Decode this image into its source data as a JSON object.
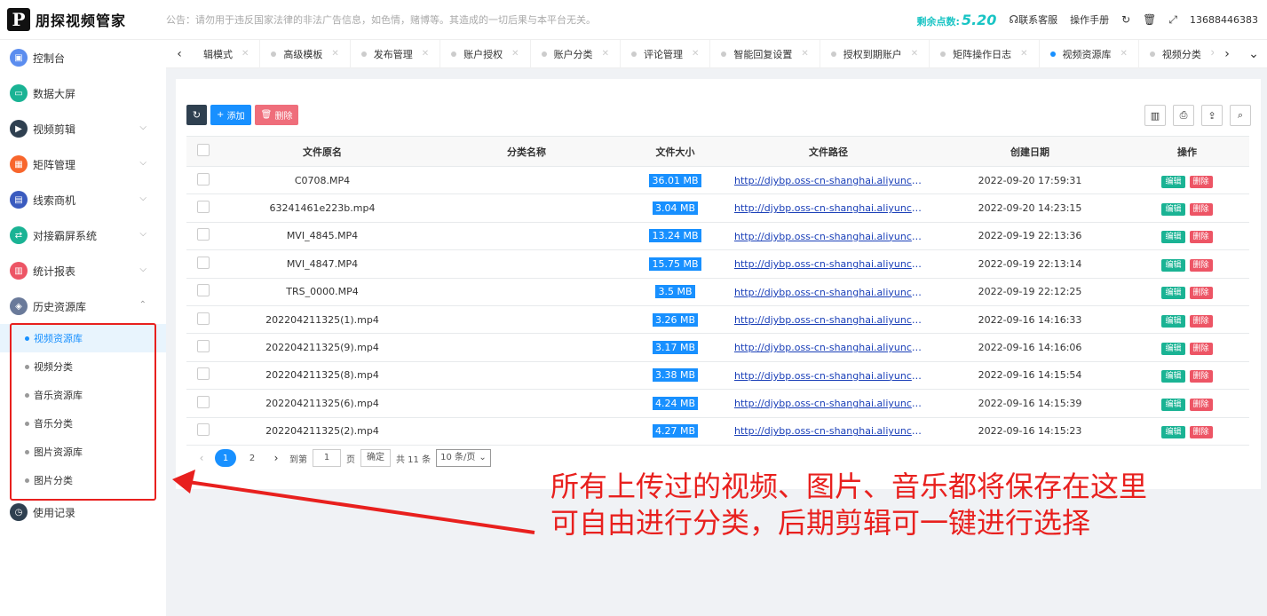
{
  "header": {
    "logo_mark": "P",
    "logo_text": "朋探视频管家",
    "notice": "公告：请勿用于违反国家法律的非法广告信息，如色情，赌博等。其造成的一切后果与本平台无关。",
    "points_label": "剩余点数:",
    "points_value": "5.20",
    "contact": "联系客服",
    "manual": "操作手册",
    "phone": "13688446383"
  },
  "sidebar": {
    "items": [
      {
        "label": "控制台",
        "color": "#5b8def",
        "icon": "dashboard-icon"
      },
      {
        "label": "数据大屏",
        "color": "#1ab394",
        "icon": "screen-icon"
      },
      {
        "label": "视频剪辑",
        "color": "#2f4050",
        "icon": "video-edit-icon"
      },
      {
        "label": "矩阵管理",
        "color": "#f8662c",
        "icon": "matrix-icon"
      },
      {
        "label": "线索商机",
        "color": "#3a5bbf",
        "icon": "lead-icon"
      },
      {
        "label": "对接霸屏系统",
        "color": "#1ab394",
        "icon": "connect-icon"
      },
      {
        "label": "统计报表",
        "color": "#ed5565",
        "icon": "report-icon"
      },
      {
        "label": "历史资源库",
        "color": "#6a7a9a",
        "icon": "archive-icon"
      },
      {
        "label": "使用记录",
        "color": "#2f4050",
        "icon": "clock-icon"
      }
    ],
    "sub_items": [
      {
        "label": "视频资源库",
        "active": true
      },
      {
        "label": "视频分类"
      },
      {
        "label": "音乐资源库"
      },
      {
        "label": "音乐分类"
      },
      {
        "label": "图片资源库"
      },
      {
        "label": "图片分类"
      }
    ]
  },
  "tabs": [
    {
      "label": "辑模式"
    },
    {
      "label": "高级模板"
    },
    {
      "label": "发布管理"
    },
    {
      "label": "账户授权"
    },
    {
      "label": "账户分类"
    },
    {
      "label": "评论管理"
    },
    {
      "label": "智能回复设置"
    },
    {
      "label": "授权到期账户"
    },
    {
      "label": "矩阵操作日志"
    },
    {
      "label": "视频资源库",
      "active": true
    },
    {
      "label": "视频分类"
    }
  ],
  "toolbar": {
    "add_label": "添加",
    "delete_label": "删除"
  },
  "table": {
    "headers": [
      "文件原名",
      "分类名称",
      "文件大小",
      "文件路径",
      "创建日期",
      "操作"
    ],
    "rows": [
      {
        "name": "C0708.MP4",
        "category": "",
        "size": "36.01 MB",
        "path": "http://djybp.oss-cn-shanghai.aliyuncs.com/",
        "date": "2022-09-20 17:59:31"
      },
      {
        "name": "63241461e223b.mp4",
        "category": "",
        "size": "3.04 MB",
        "path": "http://djybp.oss-cn-shanghai.aliyuncs.com/",
        "date": "2022-09-20 14:23:15"
      },
      {
        "name": "MVI_4845.MP4",
        "category": "",
        "size": "13.24 MB",
        "path": "http://djybp.oss-cn-shanghai.aliyuncs.com/",
        "date": "2022-09-19 22:13:36"
      },
      {
        "name": "MVI_4847.MP4",
        "category": "",
        "size": "15.75 MB",
        "path": "http://djybp.oss-cn-shanghai.aliyuncs.com/",
        "date": "2022-09-19 22:13:14"
      },
      {
        "name": "TRS_0000.MP4",
        "category": "",
        "size": "3.5 MB",
        "path": "http://djybp.oss-cn-shanghai.aliyuncs.com/",
        "date": "2022-09-19 22:12:25"
      },
      {
        "name": "202204211325(1).mp4",
        "category": "",
        "size": "3.26 MB",
        "path": "http://djybp.oss-cn-shanghai.aliyuncs.com/",
        "date": "2022-09-16 14:16:33"
      },
      {
        "name": "202204211325(9).mp4",
        "category": "",
        "size": "3.17 MB",
        "path": "http://djybp.oss-cn-shanghai.aliyuncs.com/",
        "date": "2022-09-16 14:16:06"
      },
      {
        "name": "202204211325(8).mp4",
        "category": "",
        "size": "3.38 MB",
        "path": "http://djybp.oss-cn-shanghai.aliyuncs.com/",
        "date": "2022-09-16 14:15:54"
      },
      {
        "name": "202204211325(6).mp4",
        "category": "",
        "size": "4.24 MB",
        "path": "http://djybp.oss-cn-shanghai.aliyuncs.com/",
        "date": "2022-09-16 14:15:39"
      },
      {
        "name": "202204211325(2).mp4",
        "category": "",
        "size": "4.27 MB",
        "path": "http://djybp.oss-cn-shanghai.aliyuncs.com/",
        "date": "2022-09-16 14:15:23"
      }
    ],
    "edit_label": "编辑",
    "delete_label": "删除"
  },
  "pager": {
    "pages": [
      "1",
      "2"
    ],
    "current": "1",
    "goto_label": "到第",
    "page_unit": "页",
    "confirm_label": "确定",
    "total": "共 11 条",
    "per_page": "10 条/页"
  },
  "annotation": {
    "line1": "所有上传过的视频、图片、音乐都将保存在这里",
    "line2": "可自由进行分类，后期剪辑可一键进行选择"
  }
}
